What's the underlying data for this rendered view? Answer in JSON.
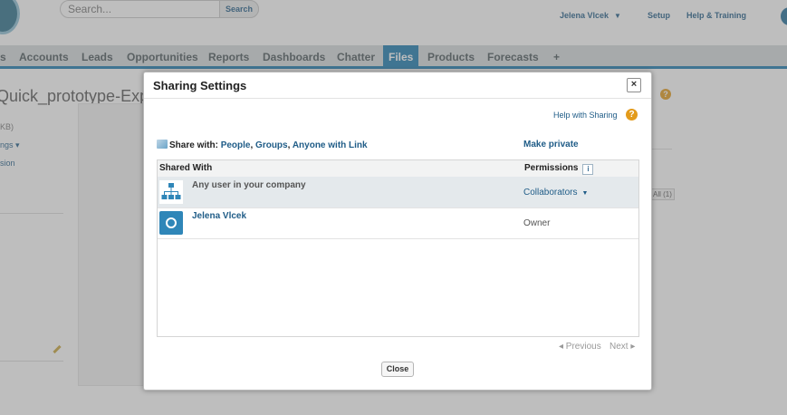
{
  "topbar": {
    "search_placeholder": "Search...",
    "search_button": "Search",
    "user_name": "Jelena Vlcek",
    "setup": "Setup",
    "help_training": "Help & Training"
  },
  "nav": {
    "tabs": [
      "s",
      "Accounts",
      "Leads",
      "Opportunities",
      "Reports",
      "Dashboards",
      "Chatter",
      "Files",
      "Products",
      "Forecasts",
      "+"
    ],
    "active": "Files"
  },
  "page": {
    "title": "Quick_prototype-Export",
    "size_fragment": "KB)",
    "settings_fragment": "ngs ▾",
    "version_fragment": "sion",
    "all_badge": "All (1)",
    "help_glyph": "?"
  },
  "modal": {
    "title": "Sharing Settings",
    "close_x": "×",
    "help_sharing": "Help with Sharing",
    "help_glyph": "?",
    "share_with_label": "Share with:",
    "share_people": "People",
    "share_groups": "Groups",
    "share_anyone": "Anyone with Link",
    "sep": ",",
    "make_private": "Make private",
    "columns": {
      "shared_with": "Shared With",
      "permissions": "Permissions",
      "info_glyph": "i"
    },
    "rows": [
      {
        "name": "Any user in your company",
        "permission": "Collaborators",
        "icon": "org-chart-icon"
      },
      {
        "name": "Jelena Vlcek",
        "permission": "Owner",
        "icon": "user-avatar-icon"
      }
    ],
    "pager_prev": "◂ Previous",
    "pager_next": "Next ▸",
    "close_button": "Close"
  },
  "colors": {
    "accent": "#1a7ab0",
    "link": "#1f5c87",
    "help": "#e39b1b"
  }
}
